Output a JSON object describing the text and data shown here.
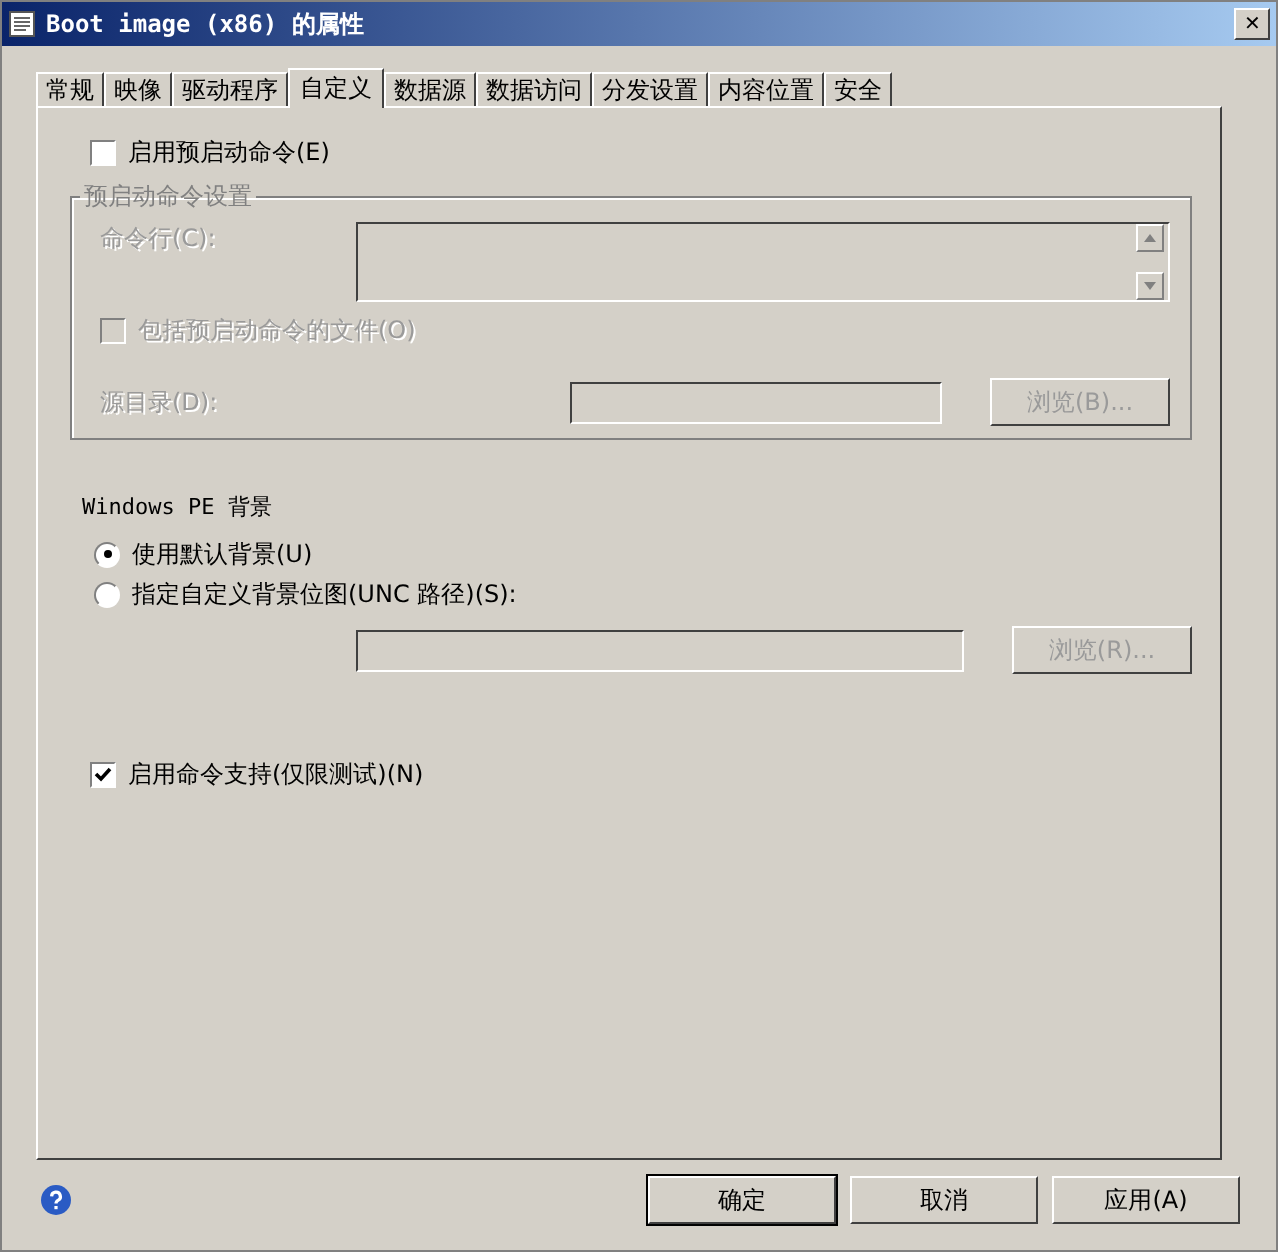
{
  "window": {
    "title": "Boot image (x86) 的属性",
    "close": "✕"
  },
  "tabs": [
    {
      "label": "常规",
      "selected": false
    },
    {
      "label": "映像",
      "selected": false
    },
    {
      "label": "驱动程序",
      "selected": false
    },
    {
      "label": "自定义",
      "selected": true
    },
    {
      "label": "数据源",
      "selected": false
    },
    {
      "label": "数据访问",
      "selected": false
    },
    {
      "label": "分发设置",
      "selected": false
    },
    {
      "label": "内容位置",
      "selected": false
    },
    {
      "label": "安全",
      "selected": false
    }
  ],
  "prestart": {
    "enable": {
      "label": "启用预启动命令(E)",
      "checked": false
    },
    "group": {
      "title": "预启动命令设置",
      "disabled": true,
      "command_label": "命令行(C):",
      "include": {
        "label": "包括预启动命令的文件(O)",
        "checked": false
      },
      "source_label": "源目录(D):",
      "browse": "浏览(B)..."
    }
  },
  "background": {
    "title": "Windows PE 背景",
    "options": [
      {
        "label": "使用默认背景(U)",
        "selected": true
      },
      {
        "label": "指定自定义背景位图(UNC 路径)(S):",
        "selected": false
      }
    ],
    "path_disabled": true,
    "browse": "浏览(R)..."
  },
  "command_support": {
    "label": "启用命令支持(仅限测试)(N)",
    "checked": true
  },
  "buttons": [
    {
      "label": "确定",
      "kind": "default"
    },
    {
      "label": "取消",
      "kind": "normal"
    },
    {
      "label": "应用(A)",
      "kind": "normal"
    }
  ]
}
